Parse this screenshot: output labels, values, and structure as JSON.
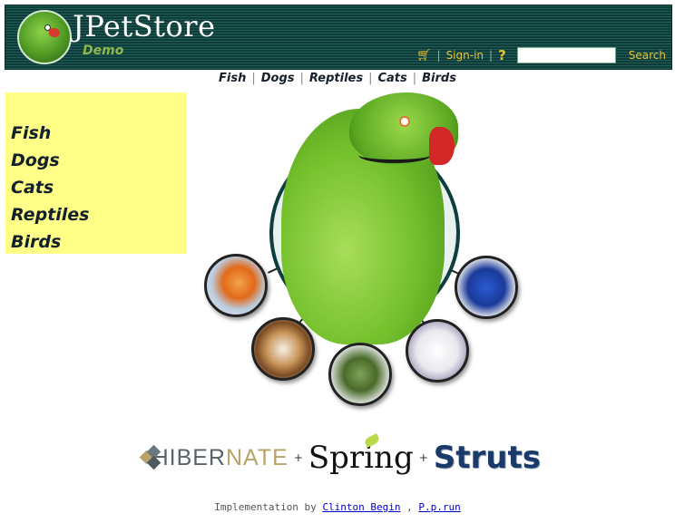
{
  "header": {
    "brand": "JPetStore",
    "subtitle": "Demo",
    "sign_in": "Sign-in",
    "help": "?",
    "search_button": "Search",
    "search_value": ""
  },
  "topnav": {
    "items": [
      "Fish",
      "Dogs",
      "Reptiles",
      "Cats",
      "Birds"
    ]
  },
  "sidebar": {
    "items": [
      "Fish",
      "Dogs",
      "Cats",
      "Reptiles",
      "Birds"
    ]
  },
  "footer": {
    "hibernate_prefix": "HIBER",
    "hibernate_suffix": "NATE",
    "plus": "+",
    "spring": "Spring",
    "struts": "Struts",
    "credit_prefix": "Implementation by",
    "credit_author": "Clinton Begin",
    "credit_sep": ",",
    "credit_other": "P.p.run"
  },
  "colors": {
    "header_bg": "#0f3b38",
    "accent_yellow": "#e6c233",
    "sidebar_bg": "#ffff88",
    "link_blue": "#0000cc"
  },
  "icons": {
    "cart": "shopping-cart-icon",
    "help": "help-icon",
    "logo": "parrot-logo-icon"
  }
}
